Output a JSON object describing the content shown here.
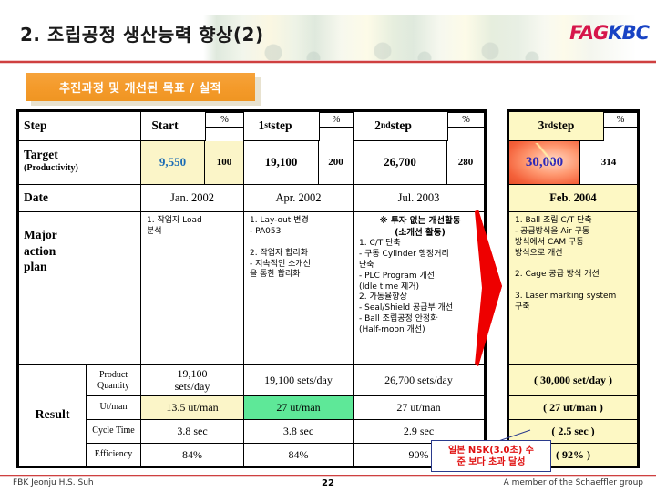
{
  "header": {
    "title": "2. 조립공정 생산능력 향상(2)",
    "logo_fag": "FAG",
    "logo_kbc": "KBC"
  },
  "section_banner": {
    "label": "추진과정 및 개선된 목표 / 실적"
  },
  "table": {
    "row_labels": {
      "step": "Step",
      "target": "Target",
      "target_sub": "(Productivity)",
      "date": "Date",
      "major_action_plan": "Major\naction\nplan",
      "result": "Result"
    },
    "percent_header": "%",
    "columns": [
      {
        "name": "Start",
        "header": "Start",
        "target": "9,550",
        "percent": "100",
        "date": "Jan. 2002",
        "plan": "1. 작업자 Load\n     분석",
        "product_quantity": "19,100\nsets/day",
        "ut_man": "13.5 ut/man",
        "cycle_time": "3.8 sec",
        "efficiency": "84%"
      },
      {
        "name": "1st step",
        "header_num": "1",
        "header_sup": "st",
        "header_rest": " step",
        "target": "19,100",
        "percent": "200",
        "date": "Apr. 2002",
        "plan": "1. Lay-out 변경\n   - PA053\n\n2. 작업자 합리화\n   - 지속적인 소개선\n     을 통한 합리화",
        "product_quantity": "19,100 sets/day",
        "ut_man": "27 ut/man",
        "cycle_time": "3.8 sec",
        "efficiency": "84%"
      },
      {
        "name": "2nd step",
        "header_num": "2",
        "header_sup": "nd",
        "header_rest": " step",
        "target": "26,700",
        "percent": "280",
        "date": "Jul. 2003",
        "plan_head": "※ 투자 없는 개선활동\n(소개선 활동)",
        "plan": "1. C/T 단축\n   - 구동 Cylinder 행정거리\n     단축\n   - PLC Program 개선\n     (Idle time 제거)\n2. 가동율향상\n   - Seal/Shield 공급부 개선\n   - Ball 조립공정 안정화\n     (Half-moon 개선)",
        "product_quantity": "26,700 sets/day",
        "ut_man": "27 ut/man",
        "cycle_time": "2.9 sec",
        "efficiency": "90%"
      },
      {
        "name": "3rd step",
        "header_num": "3",
        "header_sup": "rd",
        "header_rest": " step",
        "target": "30,000",
        "percent": "314",
        "date": "Feb. 2004",
        "plan": "1. Ball 조립 C/T 단축\n   - 공급방식을 Air 구동\n     방식에서 CAM 구동\n     방식으로 개선\n\n2. Cage  공급 방식 개선\n\n3. Laser marking system\n    구축",
        "product_quantity": "( 30,000 set/day )",
        "ut_man": "(  27 ut/man )",
        "cycle_time": "( 2.5 sec )",
        "efficiency": "( 92% )"
      }
    ],
    "result_labels": {
      "product_quantity": "Product\nQuantity",
      "ut_man": "Ut/man",
      "cycle_time": "Cycle Time",
      "efficiency": "Efficiency"
    }
  },
  "callout": {
    "text": "일본 NSK(3.0초) 수\n준 보다 초과 달성"
  },
  "footer": {
    "left": "FBK Jeonju  H.S. Suh",
    "page": "22",
    "right": "A member of the Schaeffler group"
  },
  "colors": {
    "accent_orange": "#f49a2a",
    "rule_red": "#cf4040",
    "highlight_yellow": "#fbf5c8",
    "highlight_green": "#5ee898",
    "target_blue": "#1a6bb5",
    "arrow_red": "#ee0000",
    "logo_red": "#d6164b",
    "logo_blue": "#1843c4"
  }
}
